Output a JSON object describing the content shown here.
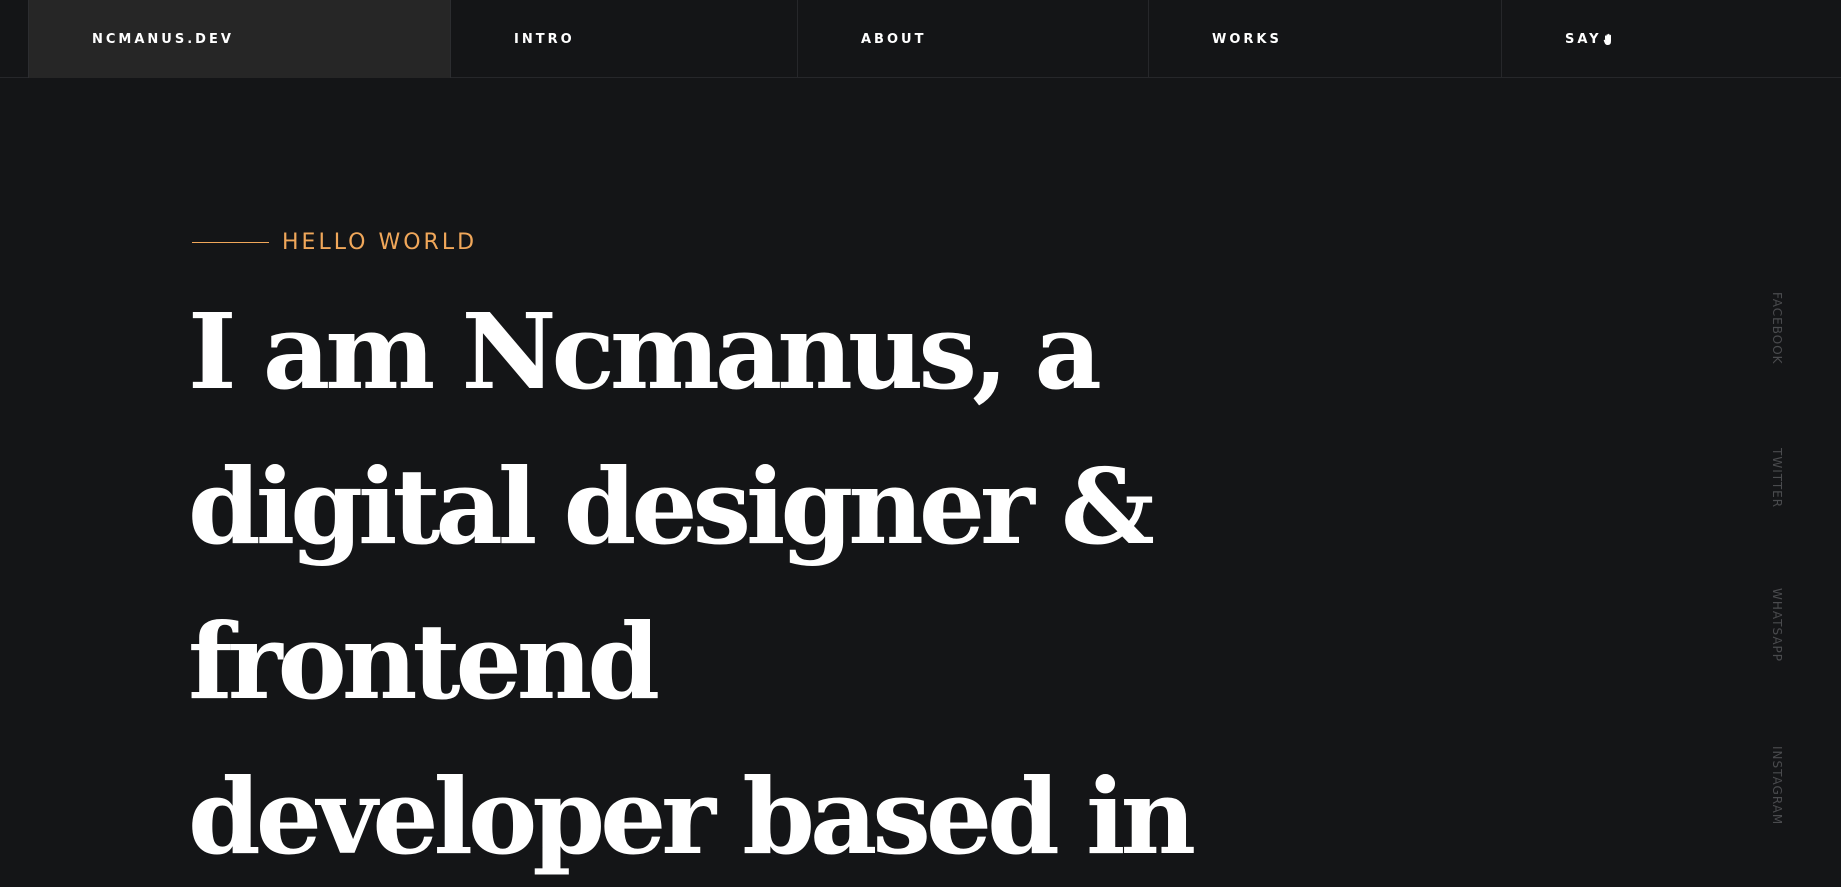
{
  "nav": {
    "brand": "NCMANUS.DEV",
    "items": [
      {
        "label": "INTRO"
      },
      {
        "label": "ABOUT"
      },
      {
        "label": "WORKS"
      },
      {
        "label": "SAY",
        "icon": "waving-hand-icon"
      }
    ]
  },
  "hero": {
    "eyebrow": "HELLO WORLD",
    "headline_lines": [
      "I am Ncmanus, a",
      "digital designer &",
      "frontend",
      "developer based in"
    ]
  },
  "social": [
    "FACEBOOK",
    "TWITTER",
    "WHATSAPP",
    "INSTAGRAM"
  ],
  "colors": {
    "background": "#141517",
    "accent": "#f0a75a",
    "brand_cell": "#262626",
    "social_text": "#4a4b4e"
  }
}
